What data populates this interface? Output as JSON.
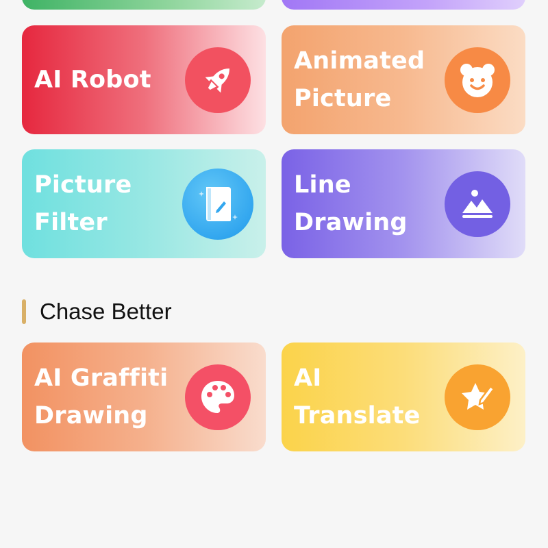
{
  "section": {
    "title": "Chase Better",
    "bar_color": "#d9b067"
  },
  "cards": {
    "ai_robot": {
      "label": "AI Robot",
      "icon": "rocket-icon"
    },
    "animated_picture": {
      "label": "Animated Picture",
      "icon": "bear-face-icon"
    },
    "picture_filter": {
      "label": "Picture Filter",
      "icon": "book-pen-icon"
    },
    "line_drawing": {
      "label": "Line Drawing",
      "icon": "mountain-image-icon"
    },
    "ai_graffiti_drawing": {
      "label": "AI Graffiti Drawing",
      "icon": "palette-icon"
    },
    "ai_translate": {
      "label": "AI Translate",
      "icon": "star-pen-icon"
    }
  }
}
